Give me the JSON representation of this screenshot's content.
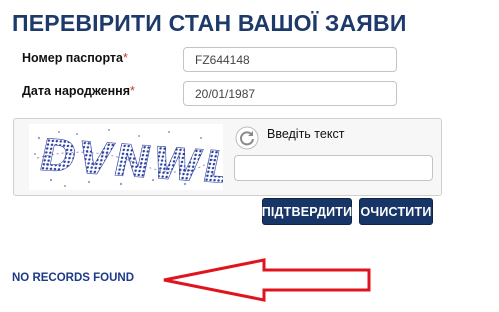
{
  "page": {
    "title": "ПЕРЕВІРИТИ СТАН ВАШОЇ ЗАЯВИ"
  },
  "form": {
    "passport_label": "Номер паспорта",
    "passport_value": "FZ644148",
    "birthdate_label": "Дата народження",
    "birthdate_value": "20/01/1987",
    "required_mark": "*"
  },
  "captcha": {
    "image_text": "DVNWL",
    "hint": "Введіть текст",
    "refresh_icon": "refresh-icon",
    "input_value": ""
  },
  "buttons": {
    "confirm": "ПІДТВЕРДИТИ",
    "clear": "ОЧИСТИТИ"
  },
  "result": {
    "message": "NO RECORDS FOUND"
  },
  "colors": {
    "title": "#1d3a6b",
    "button": "#173566",
    "required": "#c0392b",
    "annotation_arrow": "#e0141e",
    "captcha_ink": "#2b3f9e"
  }
}
